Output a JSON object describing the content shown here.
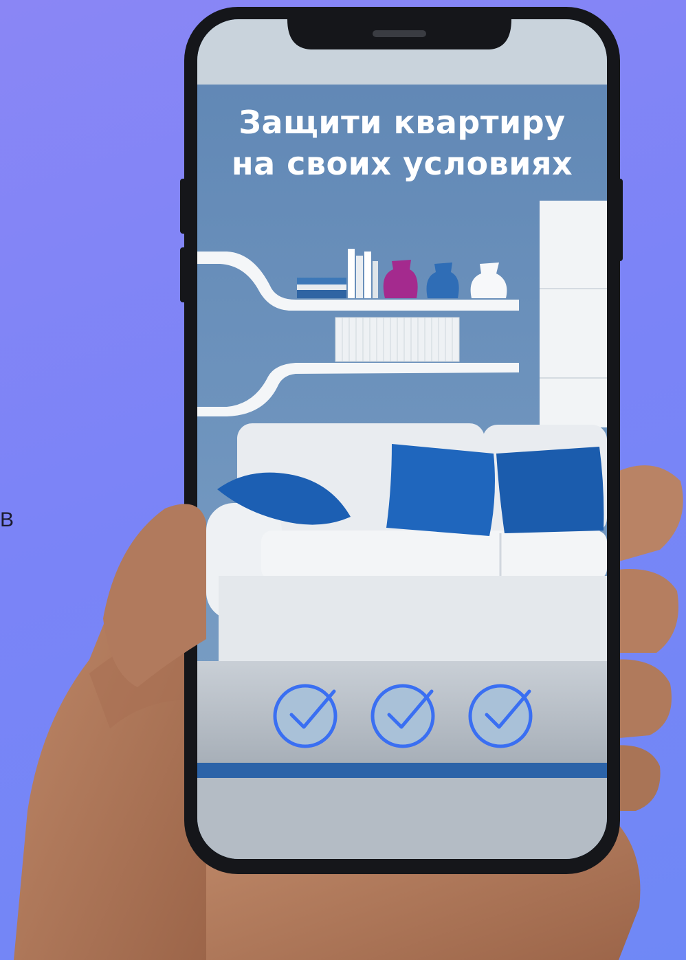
{
  "screen": {
    "headline_line1": "Защити квартиру",
    "headline_line2": "на своих условиях"
  },
  "edge_text": "В",
  "checkmarks": [
    {
      "name": "check-1"
    },
    {
      "name": "check-2"
    },
    {
      "name": "check-3"
    }
  ],
  "colors": {
    "background": "#7b84f7",
    "wall": "#6b93c0",
    "cushion": "#1d64b8",
    "check_stroke": "#3a6ff2",
    "text": "#ffffff"
  }
}
